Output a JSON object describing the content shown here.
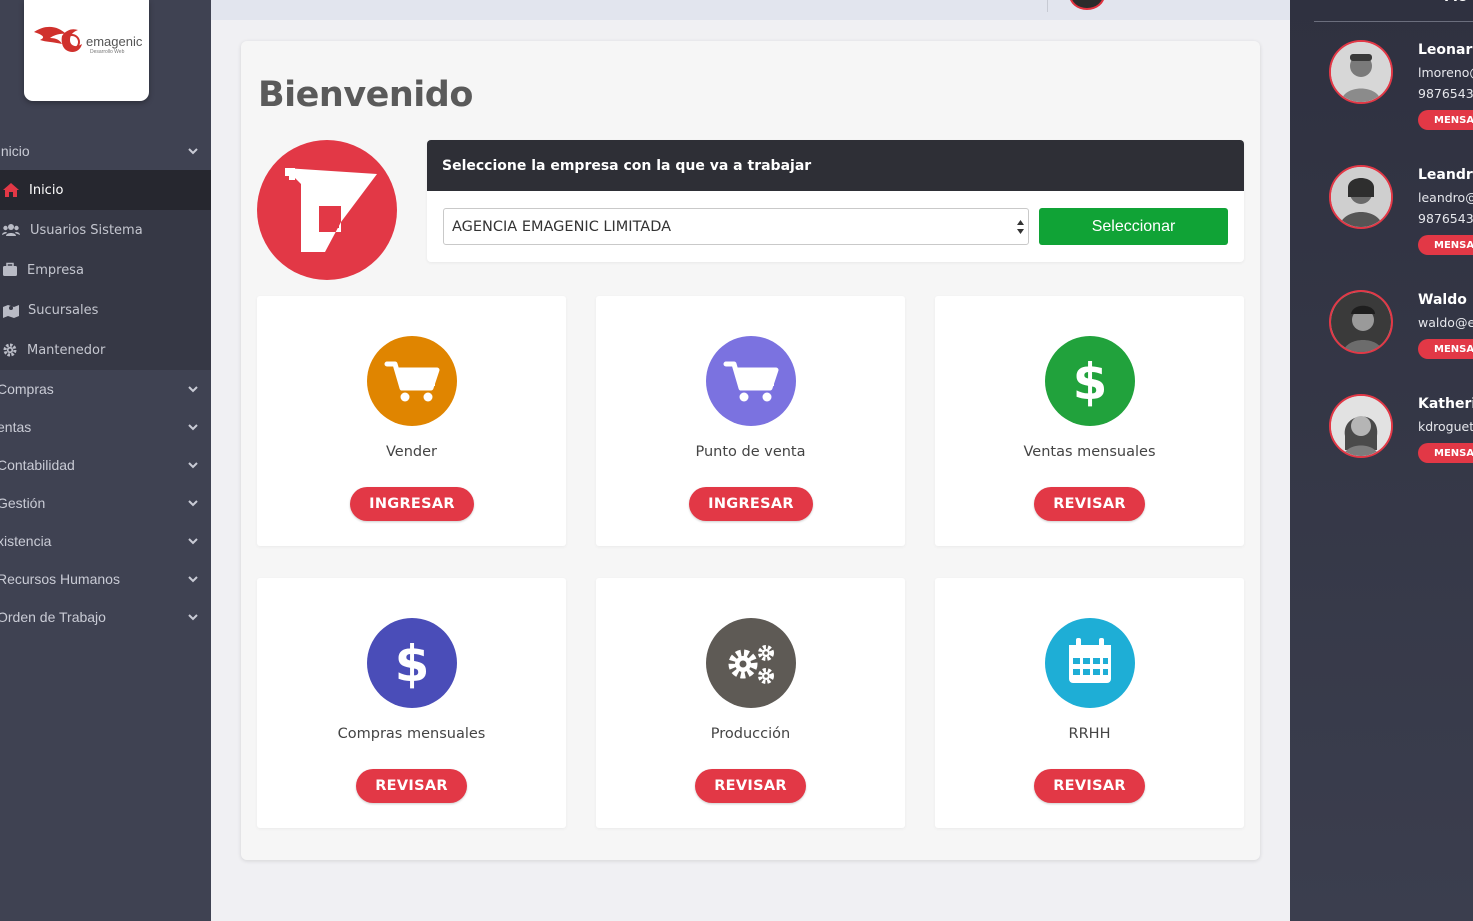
{
  "brand": {
    "logo_text": "emagenic",
    "logo_sub": "Desarrollo Web"
  },
  "sidebar": {
    "groups_top": [
      {
        "label": "Inicio",
        "icon": "chevron-down-icon"
      }
    ],
    "sub_items": [
      {
        "label": "Inicio",
        "icon": "home-icon",
        "active": true
      },
      {
        "label": "Usuarios Sistema",
        "icon": "users-icon",
        "active": false
      },
      {
        "label": "Empresa",
        "icon": "briefcase-icon",
        "active": false
      },
      {
        "label": "Sucursales",
        "icon": "map-icon",
        "active": false
      },
      {
        "label": "Mantenedor",
        "icon": "gear-icon",
        "active": false
      }
    ],
    "groups": [
      {
        "label": "Compras"
      },
      {
        "label": "entas"
      },
      {
        "label": "Contabilidad"
      },
      {
        "label": "Gestión"
      },
      {
        "label": "xistencia"
      },
      {
        "label": "Recursos Humanos"
      },
      {
        "label": "Orden de Trabajo"
      }
    ]
  },
  "main": {
    "title": "Bienvenido",
    "select_panel": {
      "heading": "Seleccione la empresa con la que va a trabajar",
      "selected_company": "AGENCIA EMAGENIC LIMITADA",
      "button_label": "Seleccionar"
    },
    "tiles": [
      {
        "name": "Vender",
        "button": "INGRESAR",
        "icon": "cart-icon",
        "color": "#e08500"
      },
      {
        "name": "Punto de venta",
        "button": "INGRESAR",
        "icon": "cart-icon",
        "color": "#7b72e0"
      },
      {
        "name": "Ventas mensuales",
        "button": "REVISAR",
        "icon": "dollar-icon",
        "color": "#21a23c"
      },
      {
        "name": "Compras mensuales",
        "button": "REVISAR",
        "icon": "dollar-icon",
        "color": "#4a4db8"
      },
      {
        "name": "Producción",
        "button": "REVISAR",
        "icon": "gears-icon",
        "color": "#5e5a55"
      },
      {
        "name": "RRHH",
        "button": "REVISAR",
        "icon": "calendar-icon",
        "color": "#1eaed6"
      }
    ]
  },
  "contacts_panel": {
    "title": "Mo",
    "contacts": [
      {
        "name": "Leonardo",
        "lines": [
          "lmoreno@",
          "9876543"
        ],
        "button": "MENSA"
      },
      {
        "name": "Leandro",
        "lines": [
          "leandro@",
          "9876543"
        ],
        "button": "MENSA"
      },
      {
        "name": "Waldo F",
        "lines": [
          "waldo@e"
        ],
        "button": "MENSA"
      },
      {
        "name": "Katherin",
        "lines": [
          "kdroguet"
        ],
        "button": "MENSA"
      }
    ]
  },
  "colors": {
    "accent": "#e23846",
    "success": "#10a336",
    "sidebar": "#3f4252",
    "dark_header": "#2e2f36"
  }
}
